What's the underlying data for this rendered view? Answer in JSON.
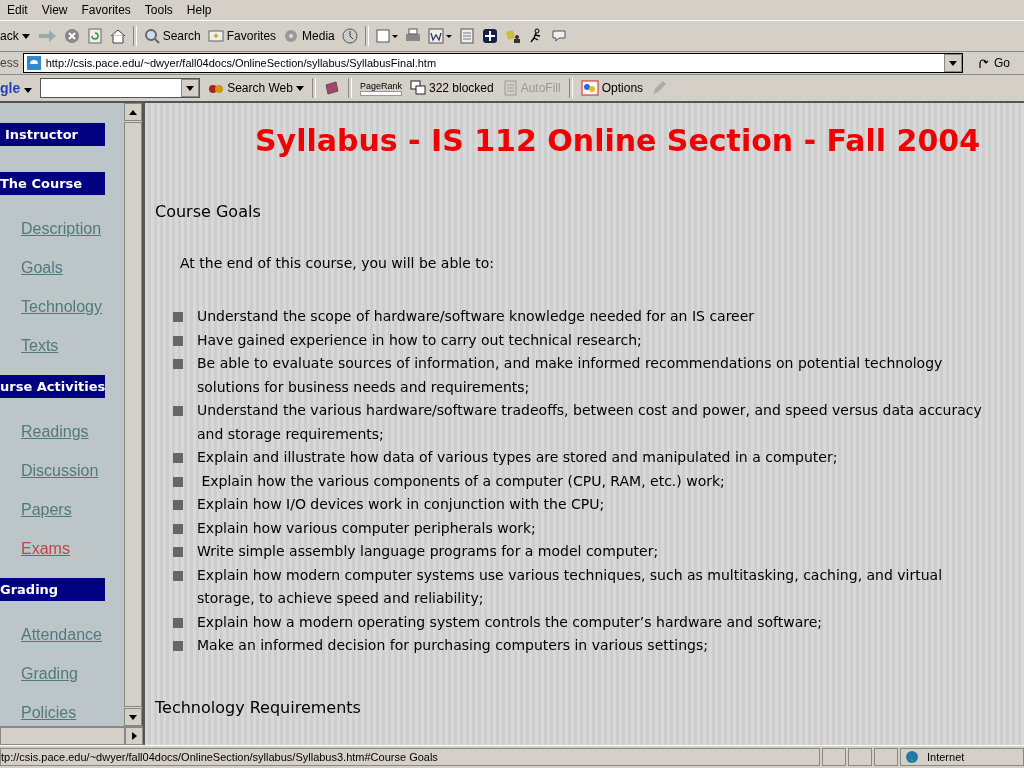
{
  "menu_bar": [
    "Edit",
    "View",
    "Favorites",
    "Tools",
    "Help"
  ],
  "toolbar": {
    "back_label": "ack",
    "search_label": "Search",
    "favorites_label": "Favorites",
    "media_label": "Media"
  },
  "address_bar": {
    "label": "ess",
    "url": "http://csis.pace.edu/~dwyer/fall04docs/OnlineSection/syllabus/SyllabusFinal.htm",
    "go_label": "Go"
  },
  "google_bar": {
    "logo": "gle",
    "search_web_label": "Search Web",
    "pagerank_label": "PageRank",
    "blocked_label": "322 blocked",
    "autofill_label": "AutoFill",
    "autofill_disabled": true,
    "options_label": "Options"
  },
  "sidebar": {
    "items": [
      {
        "kind": "header",
        "label": "Instructor",
        "active": false
      },
      {
        "kind": "header",
        "label": "The Course",
        "active": false
      },
      {
        "kind": "link",
        "label": "Description",
        "active": false
      },
      {
        "kind": "link",
        "label": "Goals",
        "active": false
      },
      {
        "kind": "link",
        "label": "Technology",
        "active": false
      },
      {
        "kind": "link",
        "label": "Texts",
        "active": false
      },
      {
        "kind": "header",
        "label": "urse Activities",
        "active": false
      },
      {
        "kind": "link",
        "label": "Readings",
        "active": false
      },
      {
        "kind": "link",
        "label": "Discussion",
        "active": false
      },
      {
        "kind": "link",
        "label": "Papers",
        "active": false
      },
      {
        "kind": "link",
        "label": "Exams",
        "active": true
      },
      {
        "kind": "header",
        "label": "Grading",
        "active": false
      },
      {
        "kind": "link",
        "label": "Attendance",
        "active": false
      },
      {
        "kind": "link",
        "label": "Grading",
        "active": false
      },
      {
        "kind": "link",
        "label": "Policies",
        "active": false
      }
    ]
  },
  "content": {
    "title": "Syllabus - IS 112 Online Section - Fall 2004",
    "section_heading": "Course Goals",
    "intro": "At the end of this course, you will be able to:",
    "goals": [
      "Understand the scope of hardware/software knowledge needed for an IS career",
      "Have gained experience in how to carry out technical research;",
      "Be able to evaluate sources of information, and make informed recommendations on potential technology solutions for business needs and requirements;",
      "Understand the various hardware/software tradeoffs, between cost and power, and speed versus data accuracy and storage requirements;",
      "Explain and illustrate how data of various types are stored and manipulated in a computer;",
      " Explain how the various components of a computer (CPU, RAM, etc.) work;",
      "Explain how I/O devices work in conjunction with the CPU;",
      "Explain how various computer peripherals work;",
      "Write simple assembly language programs for a model computer;",
      "Explain how modern computer systems use various techniques, such as multitasking, caching, and virtual storage, to achieve speed and reliability;",
      "Explain how a modern operating system controls the computer’s hardware and software;",
      "Make an informed decision for purchasing computers in various settings;"
    ],
    "next_heading": "Technology Requirements"
  },
  "status_bar": {
    "text": "tp://csis.pace.edu/~dwyer/fall04docs/OnlineSection/syllabus/Syllabus3.htm#Course Goals",
    "zone": "Internet"
  }
}
